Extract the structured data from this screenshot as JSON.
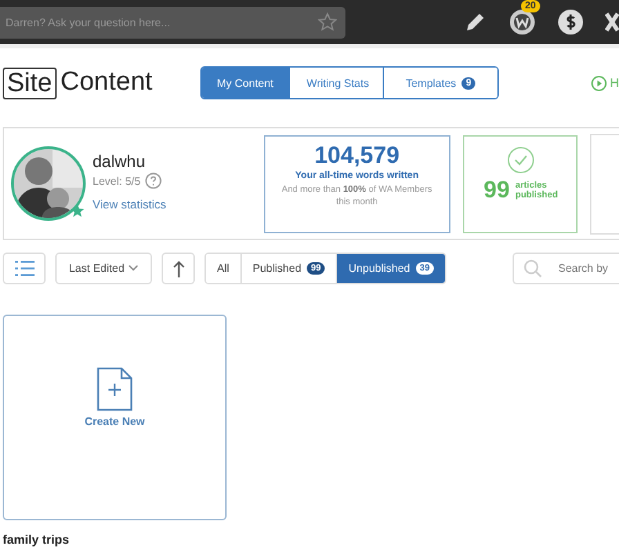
{
  "topbar": {
    "search": {
      "placeholder": "Darren? Ask your question here..."
    },
    "notification_count": "20"
  },
  "header": {
    "logo": {
      "boxed": "Site",
      "rest": "Content"
    },
    "tabs": [
      {
        "label": "My Content",
        "selected": true
      },
      {
        "label": "Writing Stats",
        "selected": false
      },
      {
        "label": "Templates",
        "count": "9",
        "selected": false
      }
    ],
    "help_link": "H"
  },
  "profile": {
    "username": "dalwhu",
    "level": "Level: 5/5",
    "stats_link": "View statistics"
  },
  "words_card": {
    "number": "104,579",
    "caption": "Your all-time words written",
    "note": "And more than **100%** of WA Members this month"
  },
  "articles_card": {
    "number": "99",
    "label": "articles published"
  },
  "toolbar": {
    "sort": "Last Edited",
    "filters": [
      {
        "label": "All",
        "selected": false
      },
      {
        "label": "Published",
        "count": "99",
        "selected": false
      },
      {
        "label": "Unpublished",
        "count": "39",
        "selected": true
      }
    ],
    "search": {
      "placeholder": "Search by"
    }
  },
  "create_card": {
    "label": "Create New"
  },
  "section_title": "family trips"
}
